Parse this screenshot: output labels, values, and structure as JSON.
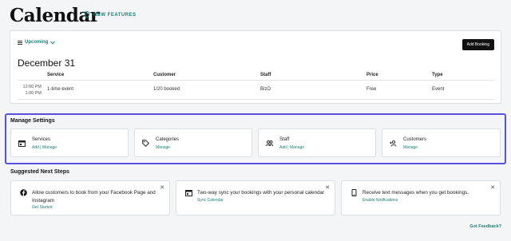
{
  "header": {
    "title": "Calendar",
    "new_features": "NEW FEATURES"
  },
  "bookings": {
    "filter_label": "Upcoming",
    "add_button": "Add Booking",
    "date": "December 31",
    "columns": [
      "Service",
      "Customer",
      "Staff",
      "Price",
      "Type"
    ],
    "row": {
      "time_start": "12:00 PM",
      "time_end": "1:00 PM",
      "service": "1-time event",
      "customer": "1/20 booked",
      "staff": "BizO",
      "price": "Free",
      "type": "Event"
    }
  },
  "manage": {
    "title": "Manage Settings",
    "tiles": [
      {
        "name": "Services",
        "links": "Add | Manage",
        "icon": "calendar-icon"
      },
      {
        "name": "Categories",
        "links": "Manage",
        "icon": "tag-icon"
      },
      {
        "name": "Staff",
        "links": "Add | Manage",
        "icon": "people-icon"
      },
      {
        "name": "Customers",
        "links": "Manage",
        "icon": "add-person-icon"
      }
    ]
  },
  "next_steps": {
    "title": "Suggested Next Steps",
    "items": [
      {
        "text1": "Allow customers to book from your Facebook Page and",
        "text2": "Instagram",
        "link": "Get Started",
        "icon": "facebook-icon"
      },
      {
        "text1": "Two-way sync your bookings with your personal calendar",
        "text2": "",
        "link": "Sync Calendar",
        "icon": "calendar-icon"
      },
      {
        "text1": "Receive text messages when you get bookings.",
        "text2": "",
        "link": "Enable Notifications",
        "icon": "phone-icon"
      }
    ]
  },
  "footer": {
    "feedback": "Got Feedback?"
  },
  "colors": {
    "accent": "#1a7f7a",
    "highlight_border": "#5b4fe0"
  }
}
